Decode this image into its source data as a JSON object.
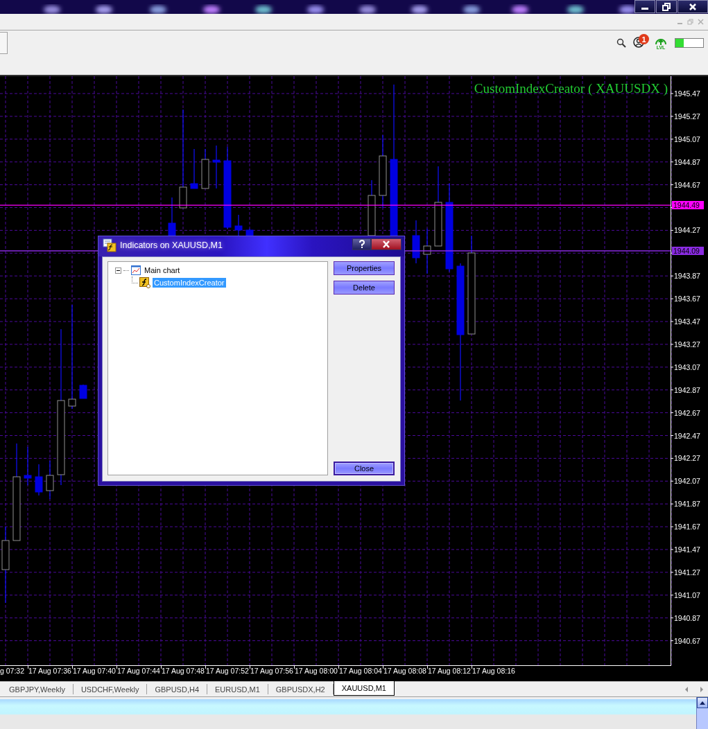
{
  "toolbar": {
    "notification_badge": "1",
    "level_label": "LVL",
    "meter": {
      "level": 0.3
    }
  },
  "chart": {
    "title": "CustomIndexCreator ( XAUUSDX )",
    "price_labels": [
      "1945.47",
      "1945.27",
      "1945.07",
      "1944.87",
      "1944.67",
      "1944.27",
      "1943.87",
      "1943.67",
      "1943.47",
      "1943.27",
      "1943.07",
      "1942.87",
      "1942.67",
      "1942.47",
      "1942.27",
      "1942.07",
      "1941.87",
      "1941.67",
      "1941.47",
      "1941.27",
      "1941.07",
      "1940.87",
      "1940.67"
    ],
    "price_markers": [
      {
        "label": "1944.49",
        "color": "#ff00ff"
      },
      {
        "label": "1944.09",
        "color": "#8a2be2"
      }
    ],
    "time_labels": [
      "g 07:32",
      "17 Aug 07:36",
      "17 Aug 07:40",
      "17 Aug 07:44",
      "17 Aug 07:48",
      "17 Aug 07:52",
      "17 Aug 07:56",
      "17 Aug 08:00",
      "17 Aug 08:04",
      "17 Aug 08:08",
      "17 Aug 08:12",
      "17 Aug 08:16"
    ]
  },
  "dialog": {
    "title": "Indicators on XAUUSD,M1",
    "tree": [
      {
        "label": "Main chart",
        "expanded": true,
        "selected": false,
        "children": [
          {
            "label": "CustomIndexCreator",
            "selected": true
          }
        ]
      }
    ],
    "buttons": [
      {
        "label": "Properties",
        "default": false
      },
      {
        "label": "Delete",
        "default": false
      },
      {
        "label": "Close",
        "default": true
      }
    ]
  },
  "tabs": [
    {
      "label": "GBPJPY,Weekly",
      "selected": false
    },
    {
      "label": "USDCHF,Weekly",
      "selected": false
    },
    {
      "label": "GBPUSD,H4",
      "selected": false
    },
    {
      "label": "EURUSD,M1",
      "selected": false
    },
    {
      "label": "GBPUSDX,H2",
      "selected": false
    },
    {
      "label": "XAUUSD,M1",
      "selected": true
    }
  ]
}
